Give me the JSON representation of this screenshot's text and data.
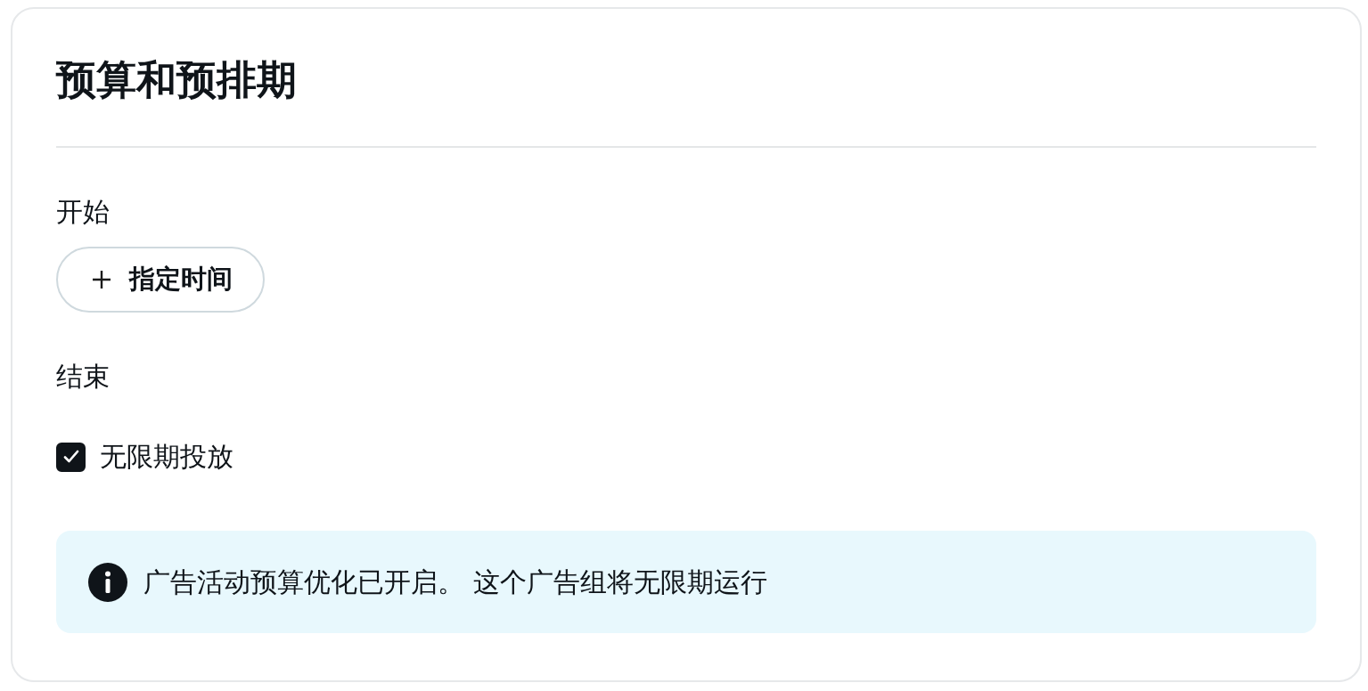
{
  "title": "预算和预排期",
  "start": {
    "label": "开始",
    "button": {
      "label": "指定时间"
    }
  },
  "end": {
    "label": "结束",
    "checkbox": {
      "label": "无限期投放",
      "checked": true
    }
  },
  "info": {
    "text": "广告活动预算优化已开启。 这个广告组将无限期运行"
  }
}
